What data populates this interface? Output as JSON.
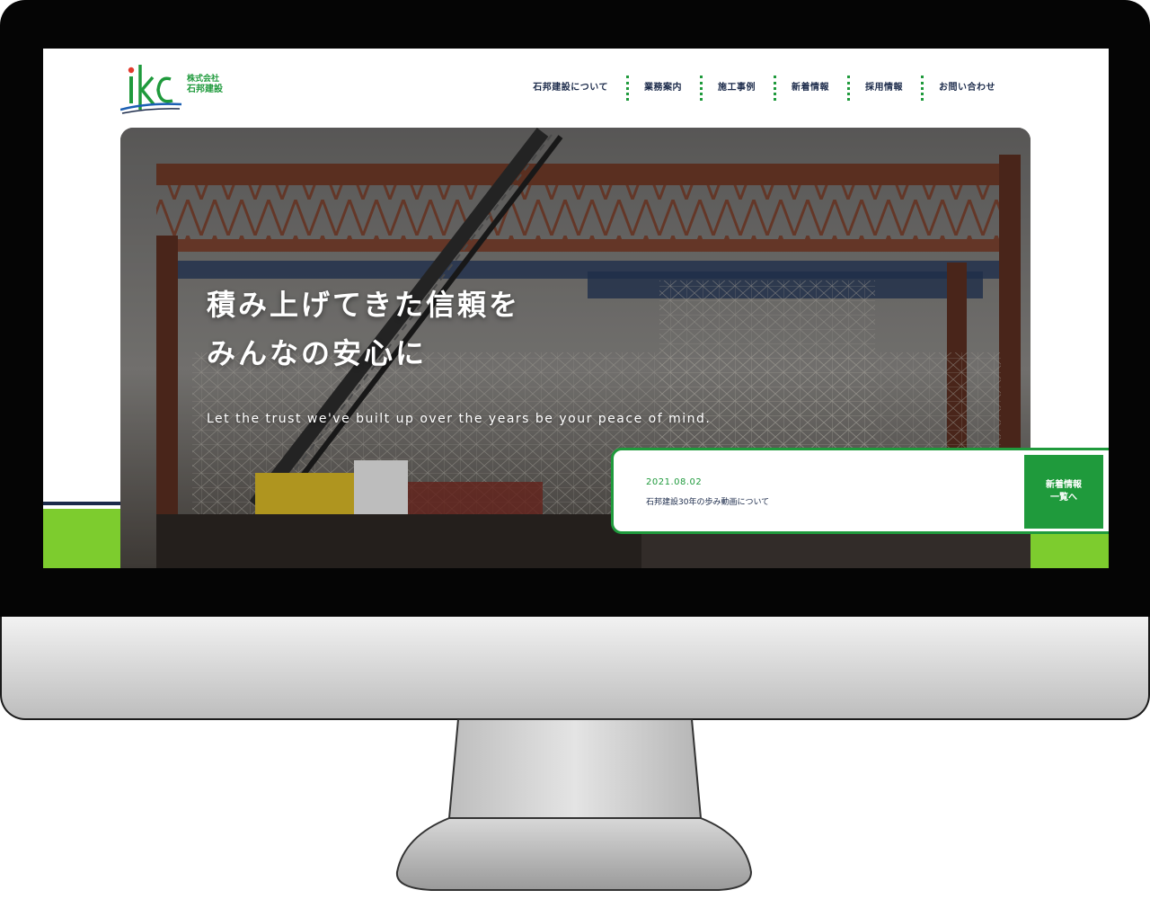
{
  "brand": {
    "mark": "ikc",
    "company_prefix": "株式会社",
    "company_name": "石邦建設",
    "accent_green": "#1f9a3c",
    "lime": "#7dcc2e",
    "navy": "#1b2a4a"
  },
  "nav": {
    "items": [
      {
        "label": "石邦建設について"
      },
      {
        "label": "業務案内"
      },
      {
        "label": "施工事例"
      },
      {
        "label": "新着情報"
      },
      {
        "label": "採用情報"
      },
      {
        "label": "お問い合わせ"
      }
    ]
  },
  "hero": {
    "title_line1": "積み上げてきた信頼を",
    "title_line2": "みんなの安心に",
    "subtitle": "Let the trust we've built up over the years be your peace of mind.",
    "image_icon": "construction-site-photo"
  },
  "news": {
    "date": "2021.08.02",
    "title": "石邦建設30年の歩み動画について",
    "button_line1": "新着情報",
    "button_line2": "一覧へ"
  }
}
